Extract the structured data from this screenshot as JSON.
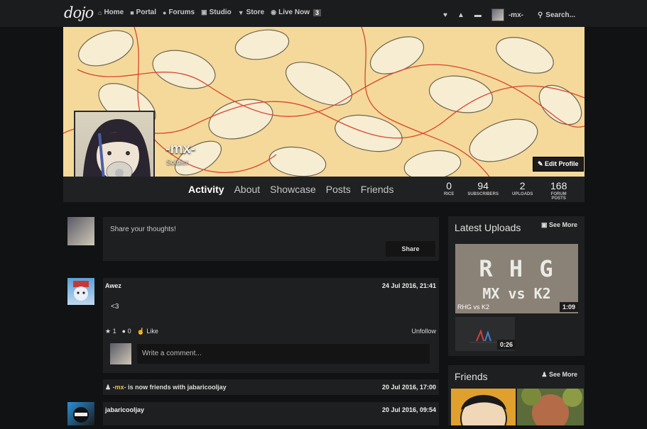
{
  "nav": {
    "logo": "dojo",
    "links": [
      {
        "label": "Home",
        "icon": "home-icon"
      },
      {
        "label": "Portal",
        "icon": "video-icon"
      },
      {
        "label": "Forums",
        "icon": "chat-icon"
      },
      {
        "label": "Studio",
        "icon": "film-icon"
      },
      {
        "label": "Store",
        "icon": "cart-icon"
      },
      {
        "label": "Live Now",
        "icon": "eye-icon"
      }
    ],
    "live_count": "3",
    "username": "-mx-",
    "search_placeholder": "Search..."
  },
  "profile": {
    "username": "-mx-",
    "rank": "Soldier",
    "edit_label": "Edit Profile",
    "tabs": [
      "Activity",
      "About",
      "Showcase",
      "Posts",
      "Friends"
    ],
    "active_tab": "Activity",
    "stats": [
      {
        "value": "0",
        "label": "RICE"
      },
      {
        "value": "94",
        "label": "SUBSCRIBERS"
      },
      {
        "value": "2",
        "label": "UPLOADS"
      },
      {
        "value": "168",
        "label": "FORUM POSTS"
      }
    ]
  },
  "composer": {
    "placeholder": "Share your thoughts!",
    "share_label": "Share"
  },
  "feed": {
    "post1": {
      "author": "Awez",
      "date": "24 Jul 2016, 21:41",
      "body": "<3",
      "stars": "1",
      "comments": "0",
      "like_label": "Like",
      "unfollow_label": "Unfollow",
      "comment_placeholder": "Write a comment..."
    },
    "activity": {
      "actor": "-mx-",
      "text": "is now friends with",
      "target": "jabaricooljay",
      "date": "20 Jul 2016, 17:00"
    },
    "post2": {
      "author": "jabaricooljay",
      "date": "20 Jul 2016, 09:54"
    }
  },
  "sidebar": {
    "uploads_title": "Latest Uploads",
    "uploads_more": "See More",
    "uploads": [
      {
        "title": "RHG vs K2",
        "duration": "1:09",
        "thumb_line1": "R H G",
        "thumb_line2": "MX vs K2"
      },
      {
        "title": "",
        "duration": "0:26"
      }
    ],
    "friends_title": "Friends",
    "friends_more": "See More"
  }
}
